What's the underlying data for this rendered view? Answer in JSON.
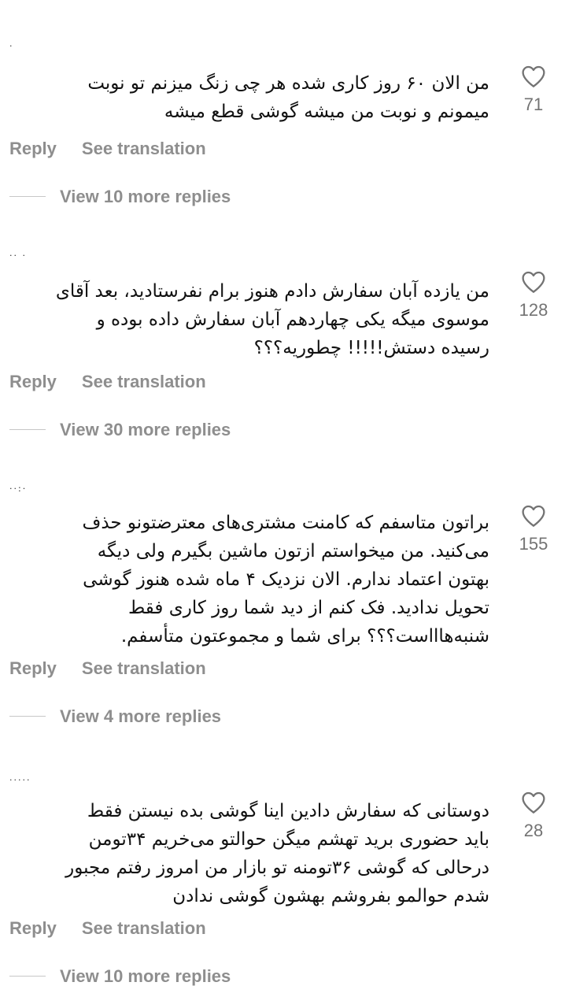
{
  "comments": [
    {
      "username": "·",
      "lines": [
        "من الان ۶۰ روز کاری شده هر چی زنگ میزنم تو نوبت",
        "میمونم و نوبت من میشه گوشی قطع میشه"
      ],
      "likes": "71",
      "reply_label": "Reply",
      "translate_label": "See translation",
      "view_replies_label": "View 10 more replies"
    },
    {
      "username": "·· ·",
      "lines": [
        "من یازده آبان سفارش دادم هنوز برام نفرستادید، بعد آقای",
        "موسوی میگه یکی چهاردهم آبان سفارش داده بوده و",
        "رسیده دستش!!!!! چطوریه؟؟؟"
      ],
      "likes": "128",
      "reply_label": "Reply",
      "translate_label": "See translation",
      "view_replies_label": "View 30 more replies"
    },
    {
      "username": "··:·",
      "lines": [
        "براتون متاسفم که کامنت مشتری‌های معترضتونو حذف",
        "می‌کنید. من میخواستم ازتون ماشین بگیرم ولی دیگه",
        "بهتون اعتماد ندارم. الان نزدیک ۴ ماه شده هنوز گوشی",
        "تحویل ندادید. فک کنم از دید شما روز کاری فقط",
        "شنبه‌هاااست؟؟؟ برای شما و مجموعتون متأسفم."
      ],
      "likes": "155",
      "reply_label": "Reply",
      "translate_label": "See translation",
      "view_replies_label": "View 4 more replies"
    },
    {
      "username": "·····",
      "lines": [
        "دوستانی که سفارش دادین اینا گوشی بده نیستن فقط",
        "باید حضوری برید تهشم میگن حوالتو می‌خریم ۳۴تومن",
        "درحالی که گوشی ۳۶تومنه تو بازار من امروز رفتم مجبور",
        "شدم حوالمو بفروشم بهشون گوشی ندادن"
      ],
      "likes": "28",
      "reply_label": "Reply",
      "translate_label": "See translation",
      "view_replies_label": "View 10 more replies"
    }
  ],
  "icons": {
    "like": "heart-outline-icon",
    "stroke_color": "#737373"
  }
}
